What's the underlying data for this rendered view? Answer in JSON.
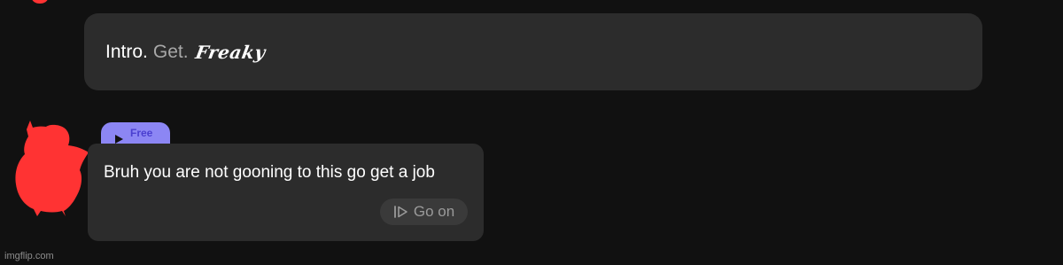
{
  "intro": {
    "label": "Intro.",
    "get": "Get.",
    "freaky": "Freaky"
  },
  "badge": {
    "label": "Free",
    "icon": "play-icon",
    "color": "#8c86f4"
  },
  "message": {
    "text": "Bruh you are not gooning to this go get a job"
  },
  "action": {
    "label": "Go on",
    "icon": "continue-icon"
  },
  "avatar": {
    "color": "#ff3333"
  },
  "watermark": "imgflip.com"
}
